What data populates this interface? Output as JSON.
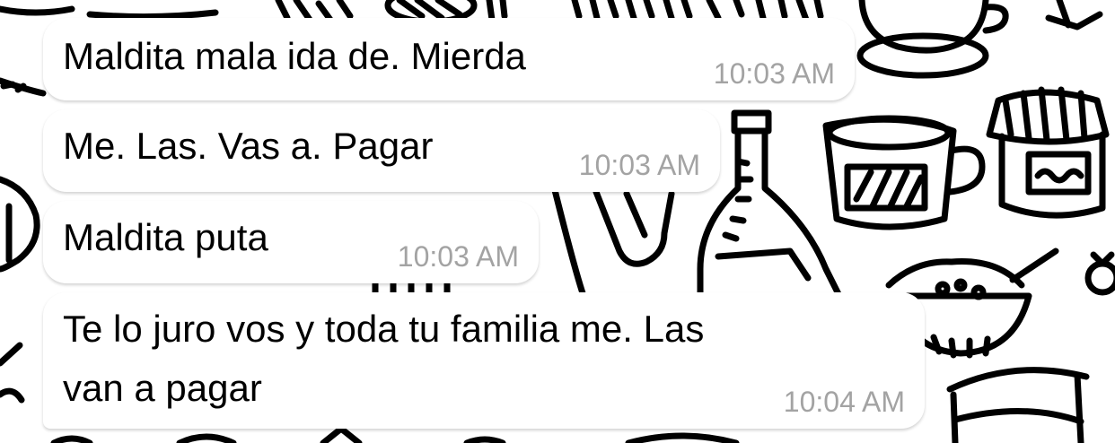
{
  "chat": {
    "messages": [
      {
        "text": "Maldita mala ida de. Mierda",
        "time": "10:03 AM"
      },
      {
        "text": "Me. Las. Vas a. Pagar",
        "time": "10:03 AM"
      },
      {
        "text": "Maldita puta",
        "time": "10:03 AM"
      },
      {
        "text_line1": "Te lo juro vos y toda tu familia me. Las",
        "text_line2": "van a pagar",
        "time": "10:04 AM"
      }
    ]
  },
  "colors": {
    "bubble_background": "#ffffff",
    "message_text": "#000000",
    "timestamp_text": "#a3a3a3",
    "wallpaper_ink": "#000000"
  }
}
